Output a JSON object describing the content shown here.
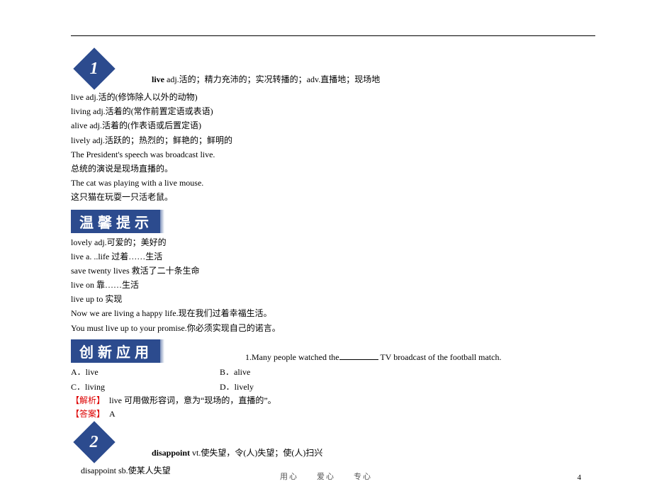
{
  "badge1": "1",
  "badge2": "2",
  "entry1_head_bold": "live",
  "entry1_head_rest": " adj.活的；精力充沛的；实况转播的；adv.直播地；现场地",
  "entry1_lines": [
    "live adj.活的(修饰除人以外的动物)",
    "living adj.活着的(常作前置定语或表语)",
    "alive adj.活着的(作表语或后置定语)",
    "lively adj.活跃的；热烈的；鲜艳的；鲜明的",
    "The President's speech was broadcast live.",
    "总统的演说是现场直播的。",
    "The cat was playing with a live mouse.",
    "这只猫在玩耍一只活老鼠。"
  ],
  "banner_tip": "温馨提示",
  "tip_lines": [
    "lovely adj.可爱的；美好的",
    "live a. ..life 过着……生活",
    "save twenty lives 救活了二十条生命",
    "live on 靠……生活",
    "live up to 实现",
    "Now we are living a happy life.现在我们过着幸福生活。",
    "You must live up to your promise.你必须实现自己的诺言。"
  ],
  "banner_app": "创新应用",
  "question_pre": "1.Many people watched the",
  "question_post": " TV broadcast of the football match.",
  "options": {
    "A": "A．live",
    "B": "B．alive",
    "C": "C．living",
    "D": "D．lively"
  },
  "analysis_label": "【解析】",
  "analysis_text": "　live 可用做形容词，意为“现场的，直播的”。",
  "answer_label": "【答案】",
  "answer_text": "　A",
  "entry2_head_bold": "disappoint",
  "entry2_head_rest": " vt.使失望，令(人)失望；使(人)扫兴",
  "entry2_line": "disappoint sb.使某人失望",
  "footer_words": "用心　　爱心　　专心",
  "page_number": "4"
}
